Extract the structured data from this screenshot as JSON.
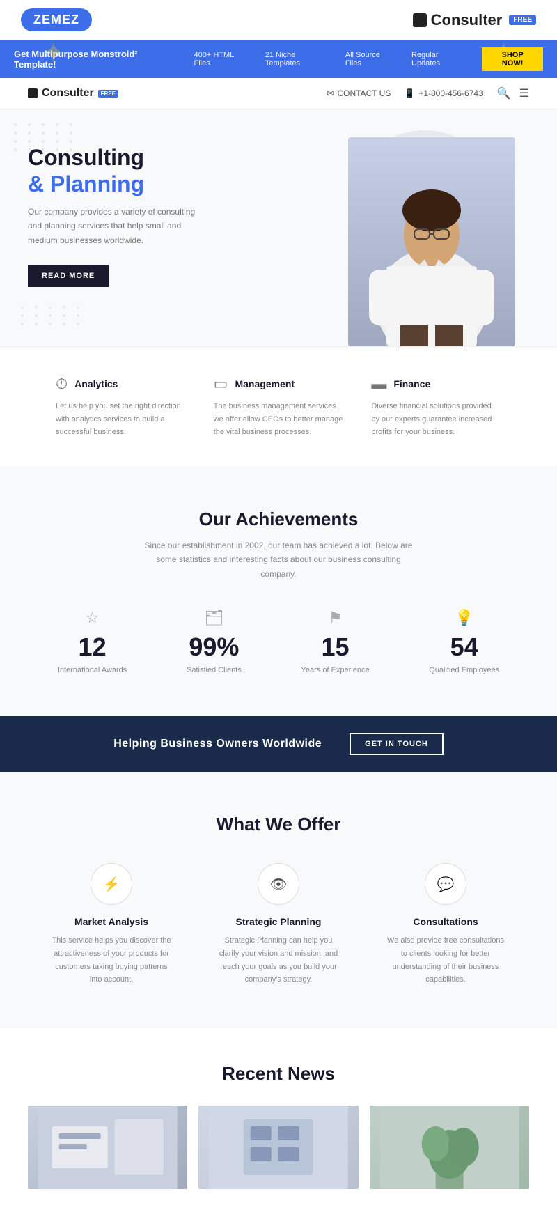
{
  "branding": {
    "zemez_label": "ZEMEZ",
    "consulter_label": "Consulter",
    "free_badge": "FREE",
    "square_icon": "■"
  },
  "promo_banner": {
    "text": "Get Multipurpose Monstroid²  Template!",
    "stat1": "400+ HTML Files",
    "stat2": "21 Niche Templates",
    "stat3": "All Source Files",
    "stat4": "Regular Updates",
    "cta_label": "SHOP NOW!"
  },
  "navbar": {
    "contact_label": "CONTACT US",
    "phone": "+1-800-456-6743",
    "search_icon": "search",
    "menu_icon": "menu"
  },
  "hero": {
    "title_line1": "Consulting",
    "title_accent": "& Planning",
    "subtitle": "Our company provides a variety of consulting and planning services that help small and medium businesses worldwide.",
    "cta_label": "READ MORE"
  },
  "services": [
    {
      "icon": "⏱",
      "title": "Analytics",
      "description": "Let us help you set the right direction with analytics services to build a successful business."
    },
    {
      "icon": "⬜",
      "title": "Management",
      "description": "The business management services we offer allow CEOs to better manage the vital business processes."
    },
    {
      "icon": "⬛",
      "title": "Finance",
      "description": "Diverse financial solutions provided by our experts guarantee increased profits for your business."
    }
  ],
  "achievements": {
    "title": "Our Achievements",
    "subtitle": "Since our establishment in 2002, our team has achieved a lot. Below are some statistics and interesting facts about our business consulting company.",
    "stats": [
      {
        "icon": "☆",
        "number": "12",
        "label": "International Awards"
      },
      {
        "icon": "🗂",
        "number": "99%",
        "label": "Satisfied Clients"
      },
      {
        "icon": "⚑",
        "number": "15",
        "label": "Years of Experience"
      },
      {
        "icon": "💡",
        "number": "54",
        "label": "Qualified Employees"
      }
    ]
  },
  "cta_banner": {
    "text": "Helping Business Owners Worldwide",
    "button_label": "GET IN TOUCH"
  },
  "offer_section": {
    "title": "What We Offer",
    "cards": [
      {
        "icon": "⚡",
        "title": "Market Analysis",
        "description": "This service helps you discover the attractiveness of your products for customers taking buying patterns into account."
      },
      {
        "icon": "👁",
        "title": "Strategic Planning",
        "description": "Strategic Planning can help you clarify your vision and mission, and reach your goals as you build your company's strategy."
      },
      {
        "icon": "💬",
        "title": "Consultations",
        "description": "We also provide free consultations to clients looking for better understanding of their business capabilities."
      }
    ]
  },
  "news_section": {
    "title": "Recent News"
  }
}
